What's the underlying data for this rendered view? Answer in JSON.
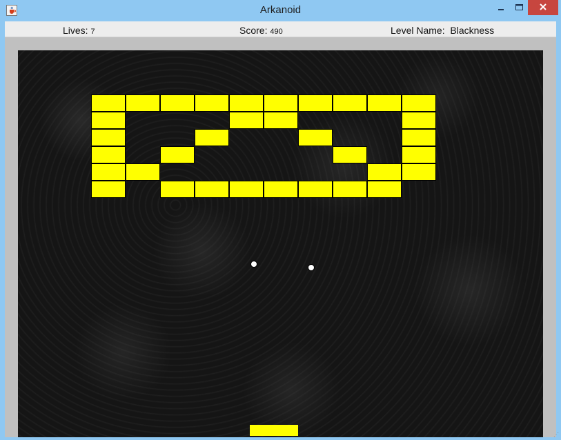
{
  "window": {
    "title": "Arkanoid",
    "icons": {
      "app": "java-cup-icon",
      "minimize": "minimize-icon",
      "maximize": "maximize-icon",
      "close": "close-icon"
    },
    "close_color": "#c7463f"
  },
  "hud": {
    "lives_label": "Lives: ",
    "lives_value": "7",
    "score_label": "Score: ",
    "score_value": "490",
    "level_label": "Level Name:  ",
    "level_value": "Blackness"
  },
  "game": {
    "brick_color": "#ffff00",
    "paddle_color": "#ffff00",
    "ball_color": "#ffffff",
    "background": "dark swirl pattern",
    "brick_grid": [
      [
        1,
        1,
        1,
        1,
        1,
        1,
        1,
        1,
        1,
        1
      ],
      [
        1,
        0,
        0,
        0,
        1,
        1,
        0,
        0,
        0,
        1
      ],
      [
        1,
        0,
        0,
        1,
        0,
        0,
        1,
        0,
        0,
        1
      ],
      [
        1,
        0,
        1,
        0,
        0,
        0,
        0,
        1,
        0,
        1
      ],
      [
        1,
        1,
        0,
        0,
        0,
        0,
        0,
        0,
        1,
        1
      ],
      [
        1,
        0,
        1,
        1,
        1,
        1,
        1,
        1,
        1,
        0
      ]
    ],
    "balls": 2
  }
}
